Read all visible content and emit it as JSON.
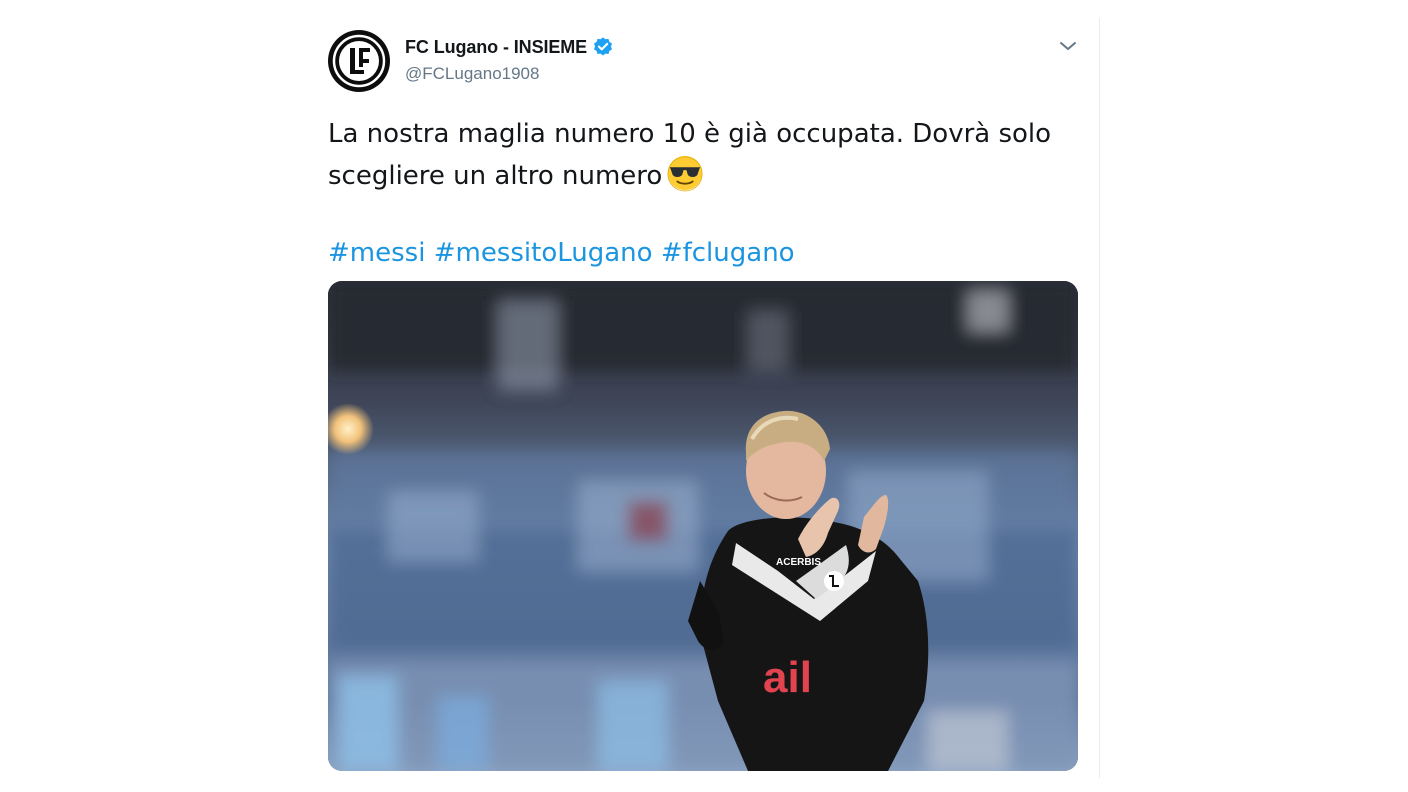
{
  "tweet": {
    "display_name": "FC Lugano - INSIEME",
    "handle": "@FCLugano1908",
    "text": "La nostra maglia numero 10 è già occupata. Dovrà solo scegliere un altro numero",
    "emoji": "smiling-face-with-sunglasses",
    "hashtags": [
      "#messi",
      "#messitoLugano",
      "#fclugano"
    ],
    "media": {
      "jersey_sponsor": "ail",
      "jersey_brand": "ACERBIS"
    }
  },
  "colors": {
    "hashtag": "#1b95e0",
    "verified": "#1da1f2",
    "name": "#14171a",
    "handle": "#657786"
  }
}
